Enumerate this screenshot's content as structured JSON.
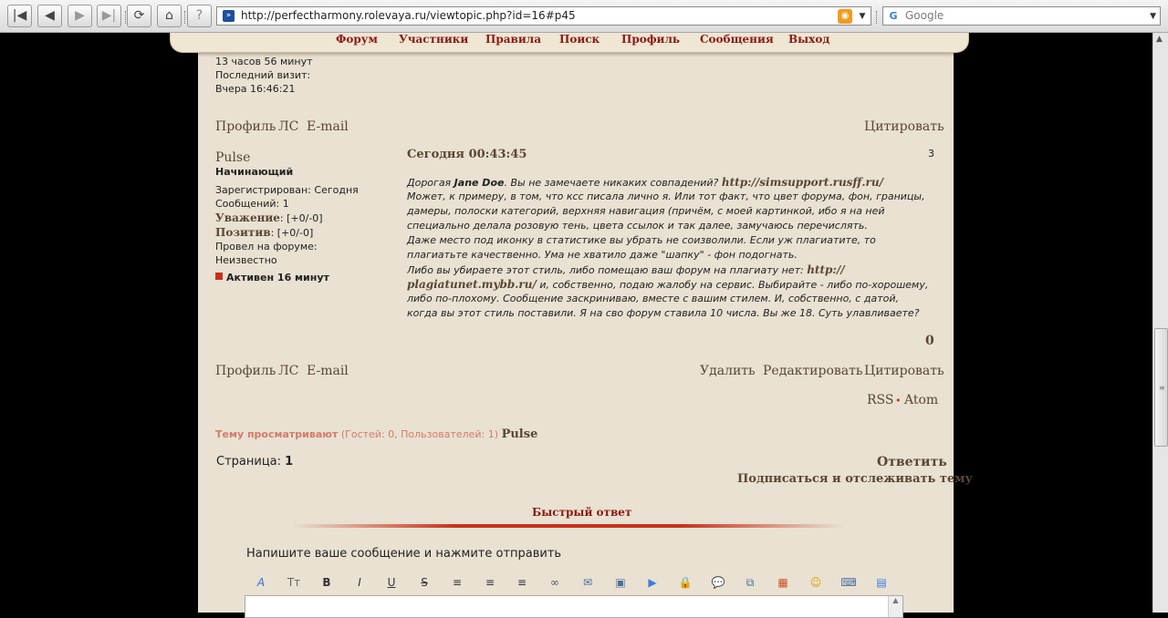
{
  "browser": {
    "url": "http://perfectharmony.rolevaya.ru/viewtopic.php?id=16#p45",
    "search_placeholder": "Google",
    "nav_glyphs": {
      "first": "|◀",
      "back": "◀",
      "forward": "▶",
      "last": "▶|",
      "reload": "⟳",
      "home": "⌂",
      "info": "?"
    }
  },
  "forum_nav": [
    "Форум",
    "Участники",
    "Правила",
    "Поиск",
    "Профиль",
    "Сообщения",
    "Выход"
  ],
  "prev_post": {
    "time_online": "13 часов 56 минут",
    "last_visit_label": "Последний визит:",
    "last_visit_value": "Вчера 16:46:21",
    "links": [
      "Профиль",
      "ЛС",
      "E-mail"
    ],
    "quote": "Цитировать"
  },
  "post": {
    "author": "Pulse",
    "rank": "Начинающий",
    "registered": "Зарегистрирован: Сегодня",
    "messages": "Сообщений: 1",
    "respect_label": "Уважение",
    "respect_value": ": [+0/-0]",
    "positive_label": "Позитив",
    "positive_value": ": [+0/-0]",
    "online_label": "Провел на форуме:",
    "online_value": "Неизвестно",
    "active": "Активен 16 минут",
    "date": "Сегодня 00:43:45",
    "number": "3",
    "lines": {
      "l1a": "Дорогая ",
      "l1b": "Jane Doe",
      "l1c": ". Вы не замечаете никаких совпадений? ",
      "l1d": "http://simsupport.rusff.ru/",
      "l2": "Может, к примеру, в том, что ксс писала лично я. Или тот факт, что цвет форума, фон, границы,",
      "l3": "дамеры, полоски категорий, верхняя навигация (причём, с моей картинкой, ибо я на ней",
      "l4": "специально делала розовую тень, цвета ссылок и так далее, замучаюсь перечислять.",
      "l5": "Даже место под иконку в статистике вы убрать не соизволили. Если уж плагиатите, то",
      "l6": "плагиатьте качественно. Ума не хватило даже \"шапку\" - фон подогнать.",
      "l7a": "Либо вы убираете этот стиль, либо помещаю ваш форум на плагиату нет: ",
      "l7b": "http://",
      "l8a": "plagiatunet.mybb.ru/",
      "l8b": " и, собственно, подаю жалобу на сервис. Выбирайте - либо по-хорошему,",
      "l9": "либо по-плохому. Сообщение заскриниваю, вместе с вашим стилем. И, собственно, с датой,",
      "l10": "когда вы этот стиль поставили. Я на сво форум ставила 10 числа. Вы же 18. Суть улавливаете?"
    },
    "rating": "0",
    "links": [
      "Профиль",
      "ЛС",
      "E-mail"
    ],
    "actions": [
      "Удалить",
      "Редактировать",
      "Цитировать"
    ]
  },
  "feeds": {
    "rss": "RSS",
    "dot": "•",
    "atom": "Atom"
  },
  "viewing": {
    "label": "Тему просматривают",
    "counts": " (Гостей: 0, Пользователей: 1) ",
    "user": "Pulse"
  },
  "pagination": {
    "label": "Страница: ",
    "current": "1"
  },
  "topic_actions": {
    "reply": "Ответить",
    "subscribe": "Подписаться и отслеживать тему"
  },
  "quick_reply": {
    "title": "Быстрый ответ",
    "prompt": "Напишите ваше сообщение и нажмите отправить"
  },
  "editor_buttons": [
    {
      "name": "font-icon",
      "glyph": "A"
    },
    {
      "name": "size-icon",
      "glyph": "Tт"
    },
    {
      "name": "bold-icon",
      "glyph": "B"
    },
    {
      "name": "italic-icon",
      "glyph": "I"
    },
    {
      "name": "underline-icon",
      "glyph": "U"
    },
    {
      "name": "strike-icon",
      "glyph": "S"
    },
    {
      "name": "align-left-icon",
      "glyph": "≡"
    },
    {
      "name": "align-center-icon",
      "glyph": "≡"
    },
    {
      "name": "align-right-icon",
      "glyph": "≡"
    },
    {
      "name": "link-icon",
      "glyph": "∞"
    },
    {
      "name": "email-icon",
      "glyph": "✉"
    },
    {
      "name": "image-icon",
      "glyph": "▣"
    },
    {
      "name": "video-icon",
      "glyph": "▶"
    },
    {
      "name": "hide-icon",
      "glyph": "🔒"
    },
    {
      "name": "quote-icon",
      "glyph": "💬"
    },
    {
      "name": "code-icon",
      "glyph": "⧉"
    },
    {
      "name": "color-icon",
      "glyph": "▦"
    },
    {
      "name": "smile-icon",
      "glyph": "☺"
    },
    {
      "name": "table-icon",
      "glyph": "⌨"
    },
    {
      "name": "upload-icon",
      "glyph": "▤"
    }
  ],
  "colors": {
    "accent": "#8b1a12",
    "link": "#5a4634",
    "page_bg": "#e9e1d1",
    "online": "#c8301b",
    "viewing": "#d47b6c"
  }
}
